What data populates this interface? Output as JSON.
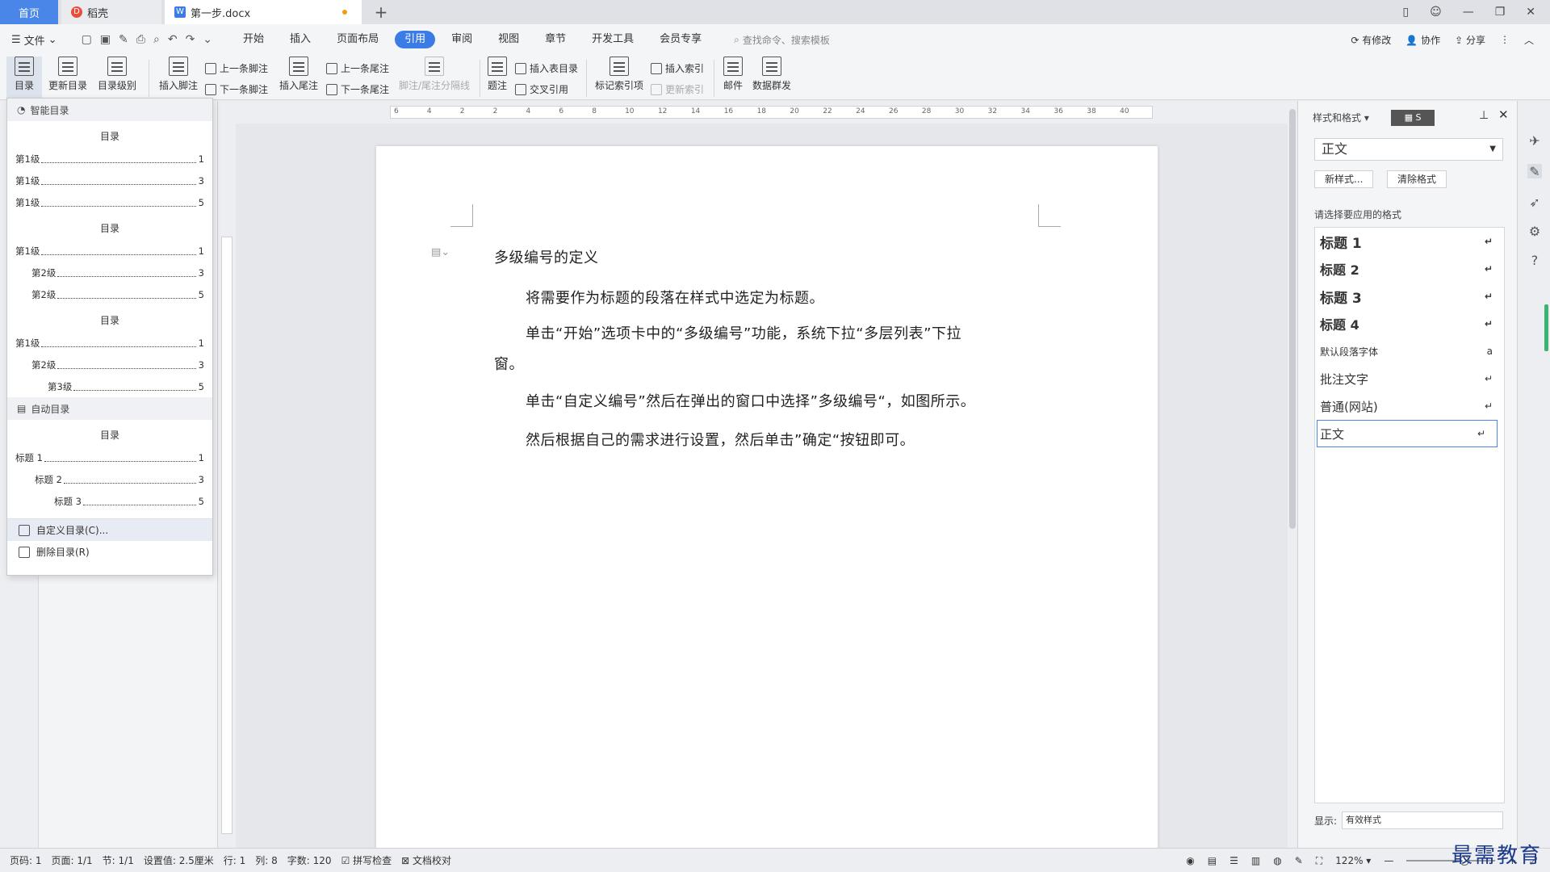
{
  "titlebar": {
    "tabs": [
      {
        "label": "首页"
      },
      {
        "label": "稻壳"
      },
      {
        "label": "第一步.docx"
      }
    ],
    "add": "+"
  },
  "menubar": {
    "file": "文件",
    "tabs": [
      "开始",
      "插入",
      "页面布局",
      "引用",
      "审阅",
      "视图",
      "章节",
      "开发工具",
      "会员专享"
    ],
    "active_tab": "引用",
    "search_placeholder": "查找命令、搜索模板",
    "right": [
      "有修改",
      "协作",
      "分享"
    ]
  },
  "ribbon": {
    "toc": "目录",
    "update_toc": "更新目录",
    "toc_level": "目录级别",
    "insert_footnote": "插入脚注",
    "prev_footnote": "上一条脚注",
    "next_footnote": "下一条脚注",
    "insert_endnote": "插入尾注",
    "prev_endnote": "上一条尾注",
    "next_endnote": "下一条尾注",
    "separator": "脚注/尾注分隔线",
    "caption": "题注",
    "insert_table_toc": "插入表目录",
    "cross_ref": "交叉引用",
    "mark_index": "标记索引项",
    "insert_index": "插入索引",
    "update_index": "更新索引",
    "mail": "邮件",
    "mass_send": "数据群发"
  },
  "toc_dropdown": {
    "smart_header": "智能目录",
    "auto_header": "自动目录",
    "title": "目录",
    "smart_groups": [
      [
        {
          "label": "第1级",
          "page": "1"
        },
        {
          "label": "第1级",
          "page": "3"
        },
        {
          "label": "第1级",
          "page": "5"
        }
      ],
      [
        {
          "label": "第1级",
          "page": "1"
        },
        {
          "label": "第2级",
          "page": "3"
        },
        {
          "label": "第2级",
          "page": "5"
        }
      ],
      [
        {
          "label": "第1级",
          "page": "1"
        },
        {
          "label": "第2级",
          "page": "3"
        },
        {
          "label": "第3级",
          "page": "5"
        }
      ]
    ],
    "auto_rows": [
      {
        "label": "标题 1",
        "page": "1"
      },
      {
        "label": "标题 2",
        "page": "3"
      },
      {
        "label": "标题 3",
        "page": "5"
      }
    ],
    "custom": "自定义目录(C)...",
    "delete": "删除目录(R)"
  },
  "document": {
    "heading": "多级编号的定义",
    "p1": "将需要作为标题的段落在样式中选定为标题。",
    "p2a": "单击“开始”选项卡中的“多级编号”功能，系统下拉“多层列表”下拉",
    "p2b": "窗。",
    "p3": "单击“自定义编号”然后在弹出的窗口中选择”多级编号“，如图所示。",
    "p4": "然后根据自己的需求进行设置，然后单击”确定“按钮即可。"
  },
  "styles_panel": {
    "title": "样式和格式",
    "current": "正文",
    "new_style": "新样式...",
    "clear_format": "清除格式",
    "apply_label": "请选择要应用的格式",
    "items": [
      "标题 1",
      "标题 2",
      "标题 3",
      "标题 4",
      "默认段落字体",
      "批注文字",
      "普通(网站)",
      "正文"
    ],
    "show_label": "显示:",
    "show_value": "有效样式"
  },
  "status": {
    "page": "页码: 1",
    "pages": "页面: 1/1",
    "section": "节: 1/1",
    "setting": "设置值: 2.5厘米",
    "row": "行: 1",
    "col": "列: 8",
    "words": "字数: 120",
    "spell": "拼写检查",
    "proof": "文档校对",
    "zoom": "122%"
  },
  "watermark": "最需教育",
  "ruler_numbers": [
    "6",
    "4",
    "2",
    "2",
    "4",
    "6",
    "8",
    "10",
    "12",
    "14",
    "16",
    "18",
    "20",
    "22",
    "24",
    "26",
    "28",
    "30",
    "32",
    "34",
    "36",
    "38",
    "40"
  ]
}
